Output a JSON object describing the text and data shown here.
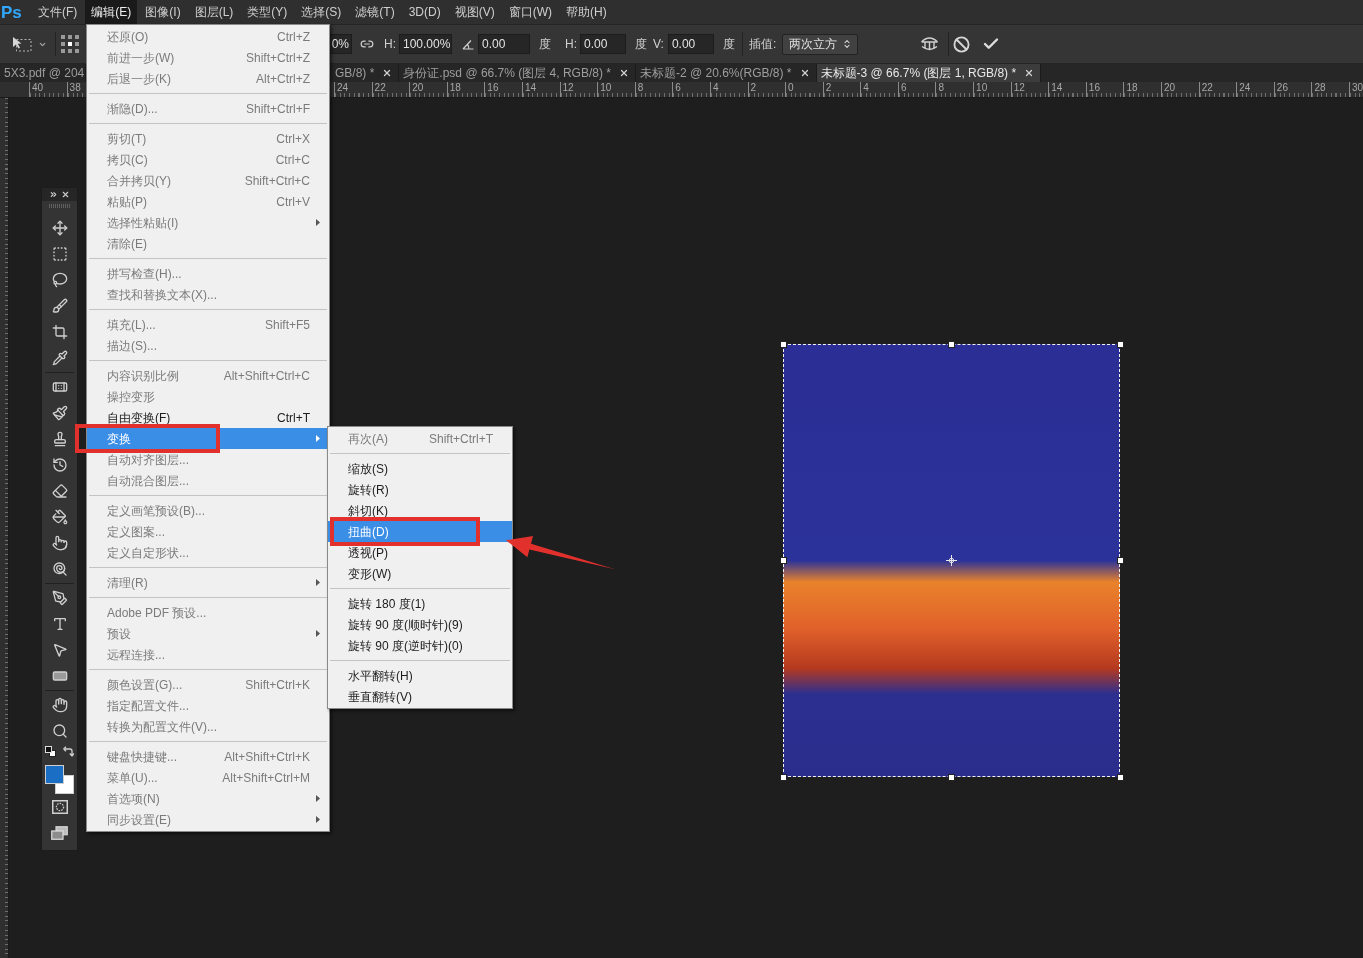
{
  "menubar": {
    "logo": "Ps",
    "items": [
      {
        "label": "文件(F)",
        "selected": false
      },
      {
        "label": "编辑(E)",
        "selected": true
      },
      {
        "label": "图像(I)",
        "selected": false
      },
      {
        "label": "图层(L)",
        "selected": false
      },
      {
        "label": "类型(Y)",
        "selected": false
      },
      {
        "label": "选择(S)",
        "selected": false
      },
      {
        "label": "滤镜(T)",
        "selected": false
      },
      {
        "label": "3D(D)",
        "selected": false
      },
      {
        "label": "视图(V)",
        "selected": false
      },
      {
        "label": "窗口(W)",
        "selected": false
      },
      {
        "label": "帮助(H)",
        "selected": false
      }
    ]
  },
  "options_bar": {
    "width_field": {
      "value": "0%"
    },
    "height_label": "H:",
    "height_field": {
      "value": "100.00%"
    },
    "angle_field": {
      "value": "0.00"
    },
    "angle_unit": "度",
    "skew_h_label": "H:",
    "skew_h_field": {
      "value": "0.00"
    },
    "skew_h_unit": "度",
    "skew_v_label": "V:",
    "skew_v_field": {
      "value": "0.00"
    },
    "skew_v_unit": "度",
    "interpolation_label": "插值:",
    "interpolation_select": {
      "value": "两次立方"
    }
  },
  "document_tabs": [
    {
      "label": "5X3.pdf @ 204",
      "selected": false
    },
    {
      "label": "GB/8) *",
      "selected": false,
      "close_button": true
    },
    {
      "label": "身份证.psd @ 66.7% (图层 4, RGB/8) *",
      "selected": false,
      "close_button": true
    },
    {
      "label": "未标题-2 @ 20.6%(RGB/8) *",
      "selected": false,
      "close_button": true
    },
    {
      "label": "未标题-3 @ 66.7% (图层 1, RGB/8) *",
      "selected": true,
      "close_button": true
    }
  ],
  "ruler": {
    "left_labels": [
      "40",
      "38"
    ],
    "right_labels": [
      "24",
      "22",
      "20",
      "18",
      "16",
      "14",
      "12",
      "10",
      "8",
      "6",
      "4",
      "2",
      "0",
      "2",
      "4",
      "6",
      "8",
      "10",
      "12",
      "14",
      "16",
      "18",
      "20",
      "22",
      "24",
      "26",
      "28",
      "30"
    ]
  },
  "tools_panel": {
    "color_swatches": [
      {
        "kind": "background",
        "color": "#ffffff"
      },
      {
        "kind": "foreground",
        "color": "#1a6fc4"
      }
    ]
  },
  "edit_menu": {
    "groups": [
      {
        "items": [
          {
            "label": "还原(O)",
            "shortcut": "Ctrl+Z",
            "disabled": true,
            "selected": false
          },
          {
            "label": "前进一步(W)",
            "shortcut": "Shift+Ctrl+Z",
            "disabled": true,
            "selected": false
          },
          {
            "label": "后退一步(K)",
            "shortcut": "Alt+Ctrl+Z",
            "disabled": true,
            "selected": false
          }
        ]
      },
      {
        "items": [
          {
            "label": "渐隐(D)...",
            "shortcut": "Shift+Ctrl+F",
            "disabled": true,
            "selected": false
          }
        ]
      },
      {
        "items": [
          {
            "label": "剪切(T)",
            "shortcut": "Ctrl+X",
            "disabled": true,
            "selected": false
          },
          {
            "label": "拷贝(C)",
            "shortcut": "Ctrl+C",
            "disabled": true,
            "selected": false
          },
          {
            "label": "合并拷贝(Y)",
            "shortcut": "Shift+Ctrl+C",
            "disabled": true,
            "selected": false
          },
          {
            "label": "粘贴(P)",
            "shortcut": "Ctrl+V",
            "disabled": true,
            "selected": false
          },
          {
            "label": "选择性粘贴(I)",
            "submenu": true,
            "disabled": true,
            "selected": false
          },
          {
            "label": "清除(E)",
            "disabled": true,
            "selected": false
          }
        ]
      },
      {
        "items": [
          {
            "label": "拼写检查(H)...",
            "disabled": true,
            "selected": false
          },
          {
            "label": "查找和替换文本(X)...",
            "disabled": true,
            "selected": false
          }
        ]
      },
      {
        "items": [
          {
            "label": "填充(L)...",
            "shortcut": "Shift+F5",
            "disabled": true,
            "selected": false
          },
          {
            "label": "描边(S)...",
            "disabled": true,
            "selected": false
          }
        ]
      },
      {
        "items": [
          {
            "label": "内容识别比例",
            "shortcut": "Alt+Shift+Ctrl+C",
            "disabled": true,
            "selected": false
          },
          {
            "label": "操控变形",
            "disabled": true,
            "selected": false
          },
          {
            "label": "自由变换(F)",
            "shortcut": "Ctrl+T",
            "disabled": false,
            "selected": false
          },
          {
            "label": "变换",
            "submenu": true,
            "disabled": false,
            "selected": true
          },
          {
            "label": "自动对齐图层...",
            "disabled": true,
            "selected": false
          },
          {
            "label": "自动混合图层...",
            "disabled": true,
            "selected": false
          }
        ]
      },
      {
        "items": [
          {
            "label": "定义画笔预设(B)...",
            "disabled": true,
            "selected": false
          },
          {
            "label": "定义图案...",
            "disabled": true,
            "selected": false
          },
          {
            "label": "定义自定形状...",
            "disabled": true,
            "selected": false
          }
        ]
      },
      {
        "items": [
          {
            "label": "清理(R)",
            "submenu": true,
            "disabled": true,
            "selected": false
          }
        ]
      },
      {
        "items": [
          {
            "label": "Adobe PDF 预设...",
            "disabled": true,
            "selected": false
          },
          {
            "label": "预设",
            "submenu": true,
            "disabled": true,
            "selected": false
          },
          {
            "label": "远程连接...",
            "disabled": true,
            "selected": false
          }
        ]
      },
      {
        "items": [
          {
            "label": "颜色设置(G)...",
            "shortcut": "Shift+Ctrl+K",
            "disabled": true,
            "selected": false
          },
          {
            "label": "指定配置文件...",
            "disabled": true,
            "selected": false
          },
          {
            "label": "转换为配置文件(V)...",
            "disabled": true,
            "selected": false
          }
        ]
      },
      {
        "items": [
          {
            "label": "键盘快捷键...",
            "shortcut": "Alt+Shift+Ctrl+K",
            "disabled": true,
            "selected": false
          },
          {
            "label": "菜单(U)...",
            "shortcut": "Alt+Shift+Ctrl+M",
            "disabled": true,
            "selected": false
          },
          {
            "label": "首选项(N)",
            "submenu": true,
            "disabled": true,
            "selected": false
          },
          {
            "label": "同步设置(E)",
            "submenu": true,
            "disabled": true,
            "selected": false
          }
        ]
      }
    ]
  },
  "transform_submenu": {
    "groups": [
      {
        "items": [
          {
            "label": "再次(A)",
            "shortcut": "Shift+Ctrl+T",
            "disabled": true,
            "selected": false
          }
        ]
      },
      {
        "items": [
          {
            "label": "缩放(S)",
            "disabled": false,
            "selected": false
          },
          {
            "label": "旋转(R)",
            "disabled": false,
            "selected": false
          },
          {
            "label": "斜切(K)",
            "disabled": false,
            "selected": false
          },
          {
            "label": "扭曲(D)",
            "disabled": false,
            "selected": true
          },
          {
            "label": "透视(P)",
            "disabled": false,
            "selected": false
          },
          {
            "label": "变形(W)",
            "disabled": false,
            "selected": false
          }
        ]
      },
      {
        "items": [
          {
            "label": "旋转 180 度(1)",
            "disabled": false,
            "selected": false
          },
          {
            "label": "旋转 90 度(顺时针)(9)",
            "disabled": false,
            "selected": false
          },
          {
            "label": "旋转 90 度(逆时针)(0)",
            "disabled": false,
            "selected": false
          }
        ]
      },
      {
        "items": [
          {
            "label": "水平翻转(H)",
            "disabled": false,
            "selected": false
          },
          {
            "label": "垂直翻转(V)",
            "disabled": false,
            "selected": false
          }
        ]
      }
    ]
  }
}
